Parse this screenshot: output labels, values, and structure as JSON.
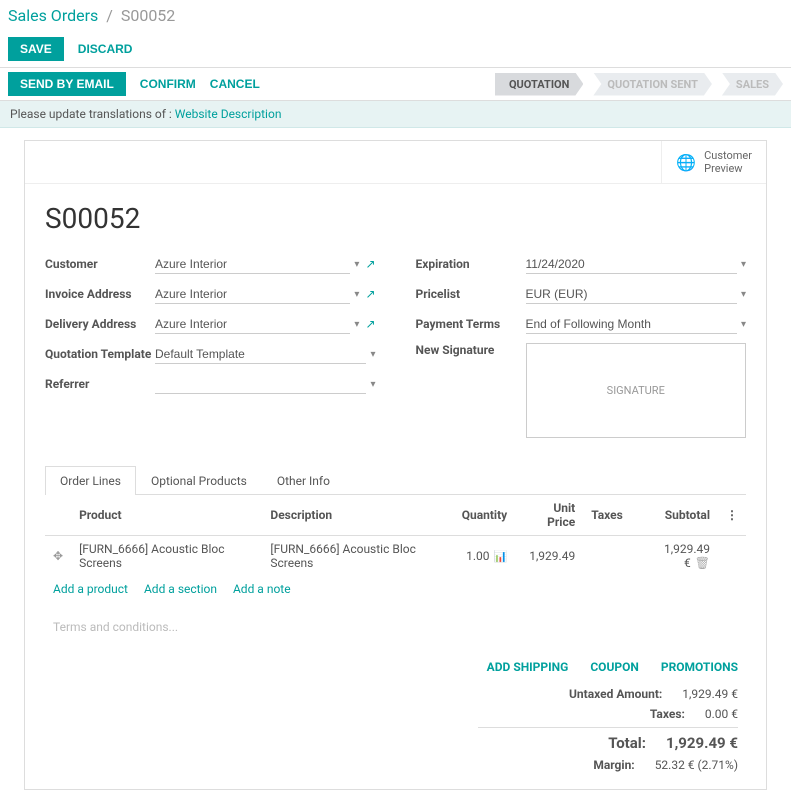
{
  "breadcrumb": {
    "root": "Sales Orders",
    "sep": "/",
    "current": "S00052"
  },
  "topbar": {
    "save": "SAVE",
    "discard": "DISCARD"
  },
  "statusbar": {
    "send": "SEND BY EMAIL",
    "confirm": "CONFIRM",
    "cancel": "CANCEL",
    "stages": {
      "quotation": "QUOTATION",
      "sent": "QUOTATION SENT",
      "sales": "SALES"
    }
  },
  "translation": {
    "prefix": "Please update translations of : ",
    "link": "Website Description"
  },
  "preview": {
    "label1": "Customer",
    "label2": "Preview"
  },
  "order": {
    "name": "S00052"
  },
  "left": {
    "customer_label": "Customer",
    "customer": "Azure Interior",
    "invoice_label": "Invoice Address",
    "invoice": "Azure Interior",
    "delivery_label": "Delivery Address",
    "delivery": "Azure Interior",
    "template_label": "Quotation Template",
    "template": "Default Template",
    "referrer_label": "Referrer",
    "referrer": ""
  },
  "right": {
    "expiration_label": "Expiration",
    "expiration": "11/24/2020",
    "pricelist_label": "Pricelist",
    "pricelist": "EUR (EUR)",
    "terms_label": "Payment Terms",
    "terms": "End of Following Month",
    "signature_label": "New Signature",
    "signature_placeholder": "SIGNATURE"
  },
  "tabs": {
    "lines": "Order Lines",
    "optional": "Optional Products",
    "other": "Other Info"
  },
  "table": {
    "headers": {
      "product": "Product",
      "description": "Description",
      "quantity": "Quantity",
      "unit": "Unit Price",
      "taxes": "Taxes",
      "subtotal": "Subtotal"
    },
    "row": {
      "product": "[FURN_6666] Acoustic Bloc Screens",
      "description": "[FURN_6666] Acoustic Bloc Screens",
      "quantity": "1.00",
      "unit": "1,929.49",
      "subtotal": "1,929.49 €"
    },
    "add_product": "Add a product",
    "add_section": "Add a section",
    "add_note": "Add a note"
  },
  "terms_placeholder": "Terms and conditions...",
  "footer": {
    "shipping": "ADD SHIPPING",
    "coupon": "COUPON",
    "promotions": "PROMOTIONS",
    "untaxed_label": "Untaxed Amount:",
    "untaxed": "1,929.49 €",
    "taxes_label": "Taxes:",
    "taxes": "0.00 €",
    "total_label": "Total:",
    "total": "1,929.49 €",
    "margin_label": "Margin:",
    "margin": "52.32 € (2.71%)"
  }
}
